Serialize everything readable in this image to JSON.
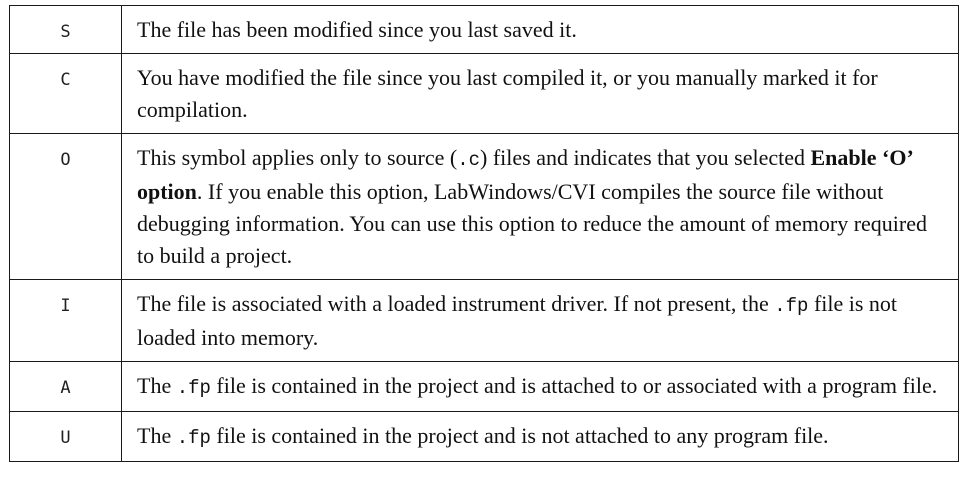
{
  "rows": [
    {
      "symbol": "S",
      "description": [
        {
          "text": "The file has been modified since you last saved it."
        }
      ]
    },
    {
      "symbol": "C",
      "description": [
        {
          "text": "You have modified the file since you last compiled it, or you manually marked it for compilation."
        }
      ]
    },
    {
      "symbol": "O",
      "description": [
        {
          "text": "This symbol applies only to source ("
        },
        {
          "text": ".c",
          "style": "mono"
        },
        {
          "text": ") files and indicates that you selected "
        },
        {
          "text": "Enable ‘O’ option",
          "style": "bold"
        },
        {
          "text": ". If you enable this option, LabWindows/CVI compiles the source file without debugging information. You can use this option to reduce the amount of memory required to build a project."
        }
      ]
    },
    {
      "symbol": "I",
      "description": [
        {
          "text": "The file is associated with a loaded instrument driver. If not present, the "
        },
        {
          "text": ".fp",
          "style": "mono"
        },
        {
          "text": " file is not loaded into memory."
        }
      ]
    },
    {
      "symbol": "A",
      "description": [
        {
          "text": "The "
        },
        {
          "text": ".fp",
          "style": "mono"
        },
        {
          "text": " file is contained in the project and is attached to or associated with a program file."
        }
      ]
    },
    {
      "symbol": "U",
      "description": [
        {
          "text": "The "
        },
        {
          "text": ".fp",
          "style": "mono"
        },
        {
          "text": " file is contained in the project and is not attached to any program file."
        }
      ]
    }
  ]
}
